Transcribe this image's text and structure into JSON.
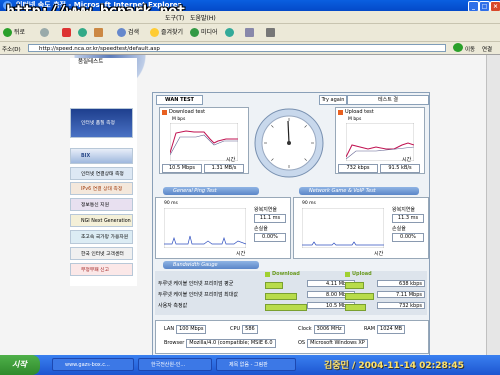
{
  "window": {
    "title": "인터넷 속도 측정 - Microsoft Internet Explorer",
    "minimize": "_",
    "maximize": "□",
    "close": "×"
  },
  "watermark": "http://www.bcpark.net",
  "menubar": {
    "items": [
      "파일(F)",
      "편집(E)",
      "보기(V)",
      "즐겨찾기(A)",
      "도구(T)",
      "도움말(H)"
    ]
  },
  "toolbar": {
    "back": "뒤로",
    "search": "검색",
    "favorites": "즐겨찾기",
    "media": "미디어"
  },
  "addressbar": {
    "label": "주소(D)",
    "url": "http://speed.nca.or.kr/speedtest/default.asp",
    "go": "이동",
    "links": "연결"
  },
  "left_panel": {
    "title": "품질테스트",
    "items": [
      "인터넷 품질 측정",
      "BIX",
      "인터넷 연결상태 측정",
      "IPv6 연결 상태 측정",
      "정보통신 지원",
      "NGI Next Generation",
      "초고속 국가망 가용자원",
      "한국 인터넷 고객센터",
      "부정부패 신고"
    ]
  },
  "wan_test": {
    "tab": "WAN TEST",
    "try_again": "Try again",
    "test_label": "테스트 결",
    "download": {
      "title": "Download test",
      "unit": "M bps",
      "axis": "시간",
      "values": [
        "10.5 Mbps",
        "1.31 MB/s"
      ]
    },
    "upload": {
      "title": "Upload test",
      "unit": "M bps",
      "axis": "시간",
      "values": [
        "732 kbps",
        "91.5 kB/s"
      ]
    },
    "sections": {
      "ping": "General Ping Test",
      "game": "Network Game & VoIP Test",
      "bandwidth": "Bandwidth Gauge"
    },
    "ping": {
      "scale": "90 ms",
      "axis": "시간",
      "avg_label": "왕복지연율",
      "avg": "11.1 ms",
      "loss_label": "손실율",
      "loss": "0.00%"
    },
    "game": {
      "scale": "90 ms",
      "axis": "시간",
      "avg_label": "왕복지연율",
      "avg": "11.3 ms",
      "loss_label": "손실율",
      "loss": "0.00%"
    },
    "bandwidth": {
      "download_head": "Download",
      "upload_head": "Upload",
      "rows": [
        {
          "label": "두루넷 케이블 인터넷 프리미엄 평균",
          "download": "4.11 Mbps",
          "upload": "638 kbps",
          "download_fill": 0.39,
          "upload_fill": 0.55
        },
        {
          "label": "두루넷 케이블 인터넷 프리미엄 최대값",
          "download": "8.00 Mbps",
          "upload": "7.11 Mbps",
          "download_fill": 0.76,
          "upload_fill": 0.9
        },
        {
          "label": "사용자 측정값",
          "download": "10.5 Mbps",
          "upload": "732 kbps",
          "download_fill": 1.0,
          "upload_fill": 0.62
        }
      ]
    },
    "info": {
      "lan_label": "LAN",
      "lan": "100 Mbps",
      "cpu_label": "CPU",
      "cpu": "586",
      "clock_label": "Clock",
      "clock": "3006 MHz",
      "ram_label": "RAM",
      "ram": "1024 MB",
      "browser_label": "Browser",
      "browser": "Mozilla/4.0 (compatible; MSIE 6.0",
      "os_label": "OS",
      "os": "Microsoft Windows XP"
    }
  },
  "taskbar": {
    "start": "시작",
    "tasks": [
      "www.gazs-box.c...",
      "한국전산원-인...",
      "제목 없음 - 그림판"
    ],
    "stamp": "김중민 / 2004-11-14 02:28:45"
  },
  "status": {
    "done": "완료"
  }
}
